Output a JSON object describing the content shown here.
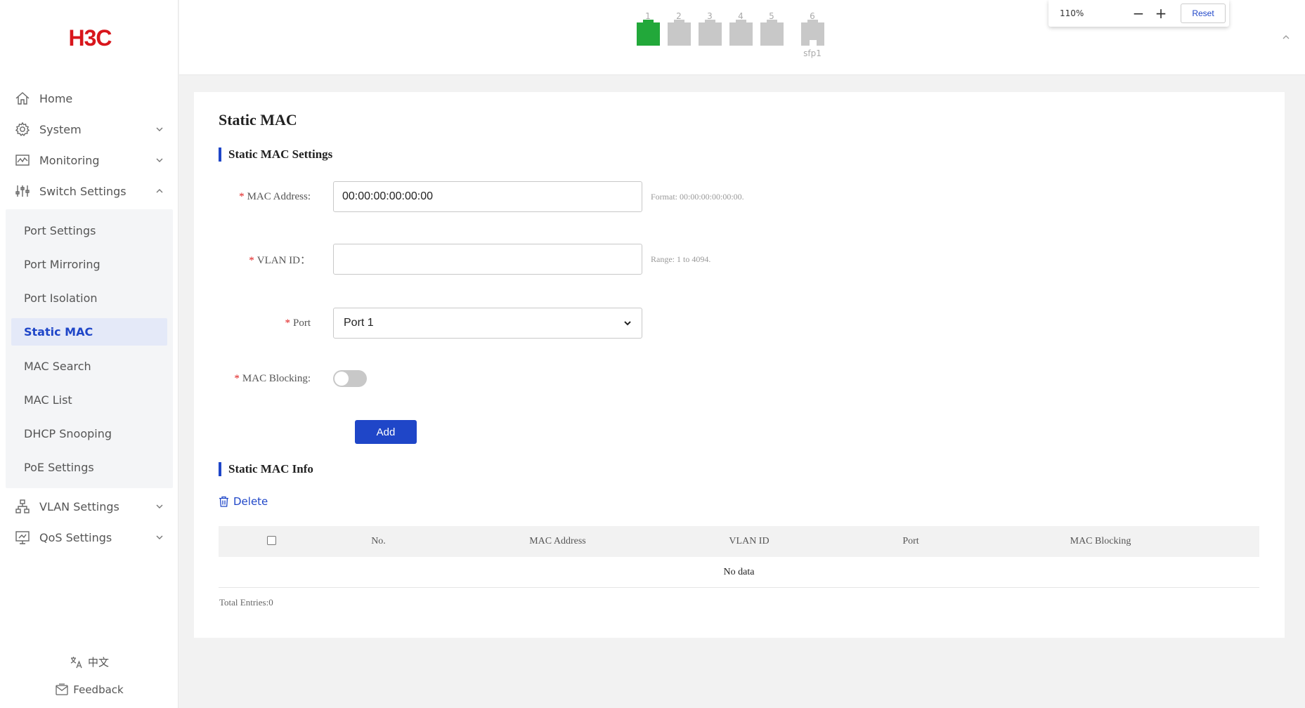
{
  "brand": {
    "logo_text": "H3C",
    "logo_color": "#d8161c"
  },
  "sidebar": {
    "items": [
      {
        "label": "Home",
        "icon": "home-icon"
      },
      {
        "label": "System",
        "icon": "gear-icon"
      },
      {
        "label": "Monitoring",
        "icon": "monitor-icon"
      },
      {
        "label": "Switch Settings",
        "icon": "sliders-icon"
      },
      {
        "label": "VLAN Settings",
        "icon": "network-icon"
      },
      {
        "label": "QoS Settings",
        "icon": "qos-icon"
      }
    ],
    "submenu": [
      {
        "label": "Port Settings"
      },
      {
        "label": "Port Mirroring"
      },
      {
        "label": "Port Isolation"
      },
      {
        "label": "Static MAC",
        "active": true
      },
      {
        "label": "MAC Search"
      },
      {
        "label": "MAC List"
      },
      {
        "label": "DHCP Snooping"
      },
      {
        "label": "PoE Settings"
      }
    ],
    "language": "中文",
    "feedback": "Feedback"
  },
  "topbar": {
    "ports": [
      {
        "num": "1",
        "status": "up"
      },
      {
        "num": "2",
        "status": "down"
      },
      {
        "num": "3",
        "status": "down"
      },
      {
        "num": "4",
        "status": "down"
      },
      {
        "num": "5",
        "status": "down"
      },
      {
        "num": "6",
        "status": "down",
        "sub": "sfp1"
      }
    ],
    "zoom": {
      "value": "110%",
      "minus": "−",
      "plus": "+",
      "reset": "Reset"
    }
  },
  "page": {
    "title": "Static MAC",
    "settings_header": "Static MAC Settings",
    "form": {
      "mac_label": "MAC Address:",
      "mac_value": "00:00:00:00:00:00",
      "mac_hint": "Format: 00:00:00:00:00:00.",
      "vlan_label": "VLAN ID：",
      "vlan_value": "",
      "vlan_hint": "Range: 1 to 4094.",
      "port_label": "Port",
      "port_value": "Port 1",
      "blocking_label": "MAC Blocking:",
      "blocking_on": false,
      "required_mark": "*",
      "add_label": "Add"
    },
    "info_header": "Static MAC Info",
    "delete_label": "Delete",
    "table": {
      "columns": [
        "No.",
        "MAC Address",
        "VLAN ID",
        "Port",
        "MAC Blocking"
      ],
      "empty_text": "No data"
    },
    "total": "Total Entries:0"
  },
  "colors": {
    "accent": "#1f46c8",
    "port_up": "#22a83a",
    "port_down": "#c8c8c8",
    "required": "#e02020"
  }
}
